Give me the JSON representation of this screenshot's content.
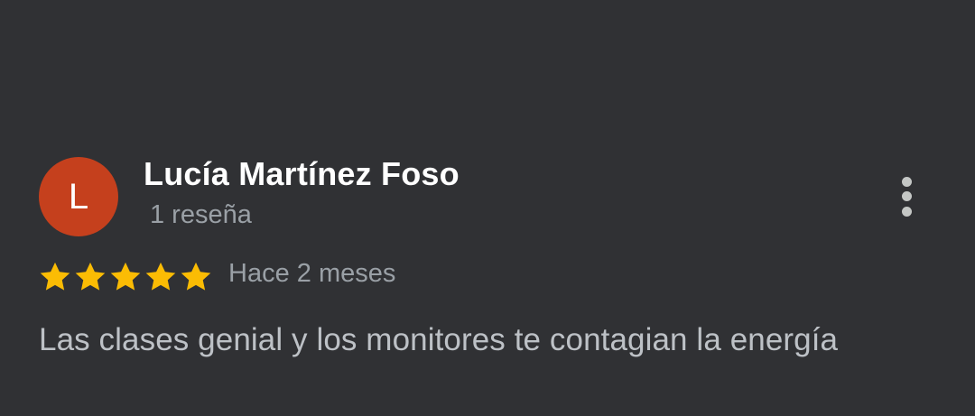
{
  "review": {
    "avatar_letter": "L",
    "avatar_color": "#c5401d",
    "author": "Lucía Martínez Foso",
    "review_count": "1 reseña",
    "rating": 5,
    "rating_max": 5,
    "star_color": "#fbbc04",
    "date": "Hace 2 meses",
    "text": "Las clases genial y los monitores te contagian la energía",
    "menu_icon": "more-vert-icon"
  }
}
